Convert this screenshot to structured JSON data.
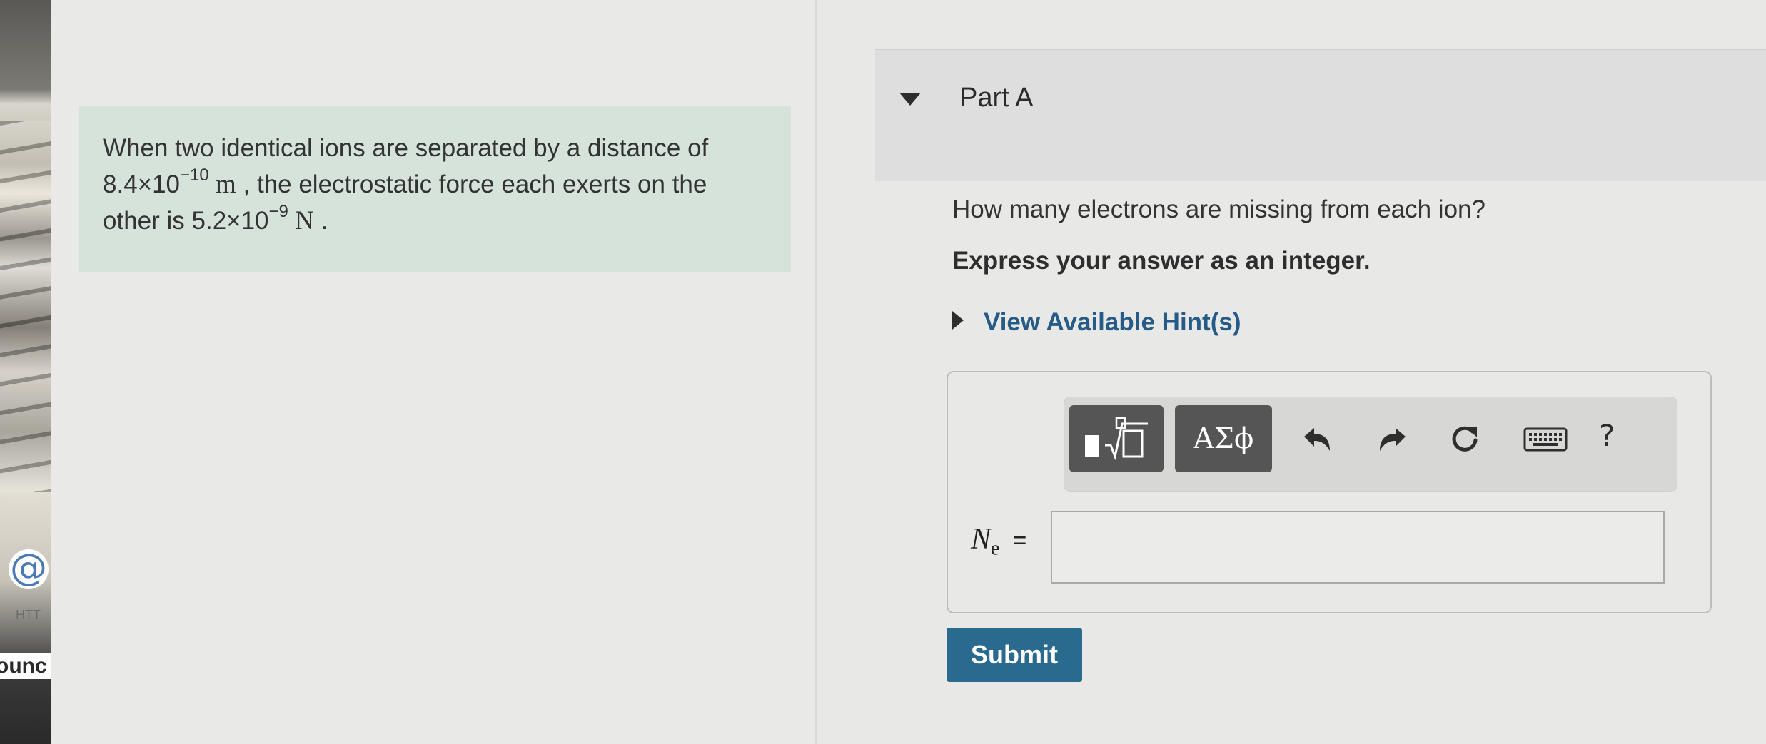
{
  "desktop": {
    "htt_label": "HTT",
    "func_label": "ounc",
    "at_symbol": "@"
  },
  "problem": {
    "text_1": "When two identical ions are separated by a distance of",
    "distance_mantissa": "8.4×10",
    "distance_exponent": "−10",
    "distance_unit": " m",
    "text_2": " , the electrostatic force each exerts on the",
    "text_3": "other is ",
    "force_mantissa": "5.2×10",
    "force_exponent": "−9",
    "force_unit": " N",
    "text_4": " ."
  },
  "part": {
    "title": "Part A",
    "question": "How many electrons are missing from each ion?",
    "instruction": "Express your answer as an integer.",
    "hint_link": "View Available Hint(s)"
  },
  "toolbar": {
    "greek_label": "ΑΣϕ",
    "help_label": "?",
    "icons": [
      "templates-icon",
      "undo-icon",
      "redo-icon",
      "reset-icon",
      "keyboard-icon",
      "help-icon"
    ]
  },
  "answer": {
    "variable": "N",
    "subscript": "e",
    "equals": "=",
    "value": ""
  },
  "submit_label": "Submit",
  "colors": {
    "problem_bg": "#d6e3db",
    "submit_bg": "#2a6a8f",
    "hint_link": "#255b86",
    "toolbar_button": "#555555"
  }
}
